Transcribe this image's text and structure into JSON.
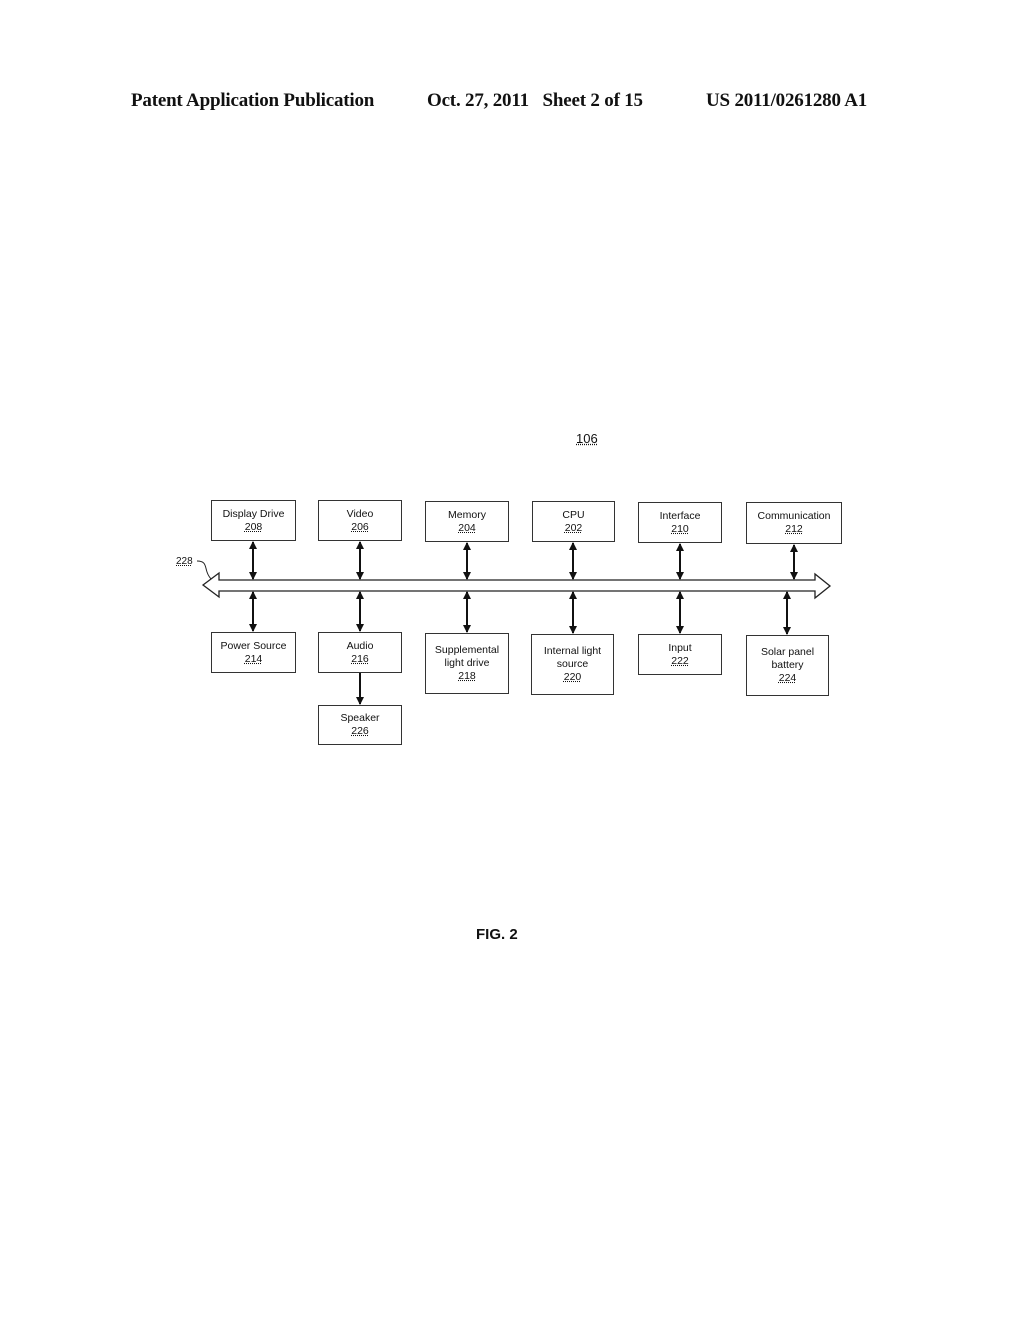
{
  "header": {
    "publication": "Patent Application Publication",
    "date_sheet": "Oct. 27, 2011   Sheet 2 of 15",
    "patent_number": "US 2011/0261280 A1"
  },
  "diagram": {
    "reference": "106",
    "bus_reference": "228",
    "figure_label": "FIG. 2",
    "top_row": [
      {
        "label": "Display Drive",
        "number": "208"
      },
      {
        "label": "Video",
        "number": "206"
      },
      {
        "label": "Memory",
        "number": "204"
      },
      {
        "label": "CPU",
        "number": "202"
      },
      {
        "label": "Interface",
        "number": "210"
      },
      {
        "label": "Communication",
        "number": "212"
      }
    ],
    "bottom_row": [
      {
        "label": "Power Source",
        "number": "214"
      },
      {
        "label": "Audio",
        "number": "216"
      },
      {
        "label_line1": "Supplemental",
        "label_line2": "light drive",
        "number": "218"
      },
      {
        "label_line1": "Internal light",
        "label_line2": "source",
        "number": "220"
      },
      {
        "label": "Input",
        "number": "222"
      },
      {
        "label_line1": "Solar panel",
        "label_line2": "battery",
        "number": "224"
      }
    ],
    "audio_output": {
      "label": "Speaker",
      "number": "226"
    },
    "connections": [
      {
        "from": "Display Drive",
        "to": "bus",
        "type": "bidirectional"
      },
      {
        "from": "Video",
        "to": "bus",
        "type": "bidirectional"
      },
      {
        "from": "Memory",
        "to": "bus",
        "type": "bidirectional"
      },
      {
        "from": "CPU",
        "to": "bus",
        "type": "bidirectional"
      },
      {
        "from": "Interface",
        "to": "bus",
        "type": "bidirectional"
      },
      {
        "from": "Communication",
        "to": "bus",
        "type": "bidirectional"
      },
      {
        "from": "Power Source",
        "to": "bus",
        "type": "bidirectional"
      },
      {
        "from": "Audio",
        "to": "bus",
        "type": "bidirectional"
      },
      {
        "from": "Supplemental light drive",
        "to": "bus",
        "type": "bidirectional"
      },
      {
        "from": "Internal light source",
        "to": "bus",
        "type": "bidirectional"
      },
      {
        "from": "Input",
        "to": "bus",
        "type": "bidirectional"
      },
      {
        "from": "Solar panel battery",
        "to": "bus",
        "type": "bidirectional"
      },
      {
        "from": "Audio",
        "to": "Speaker",
        "type": "unidirectional"
      }
    ]
  }
}
